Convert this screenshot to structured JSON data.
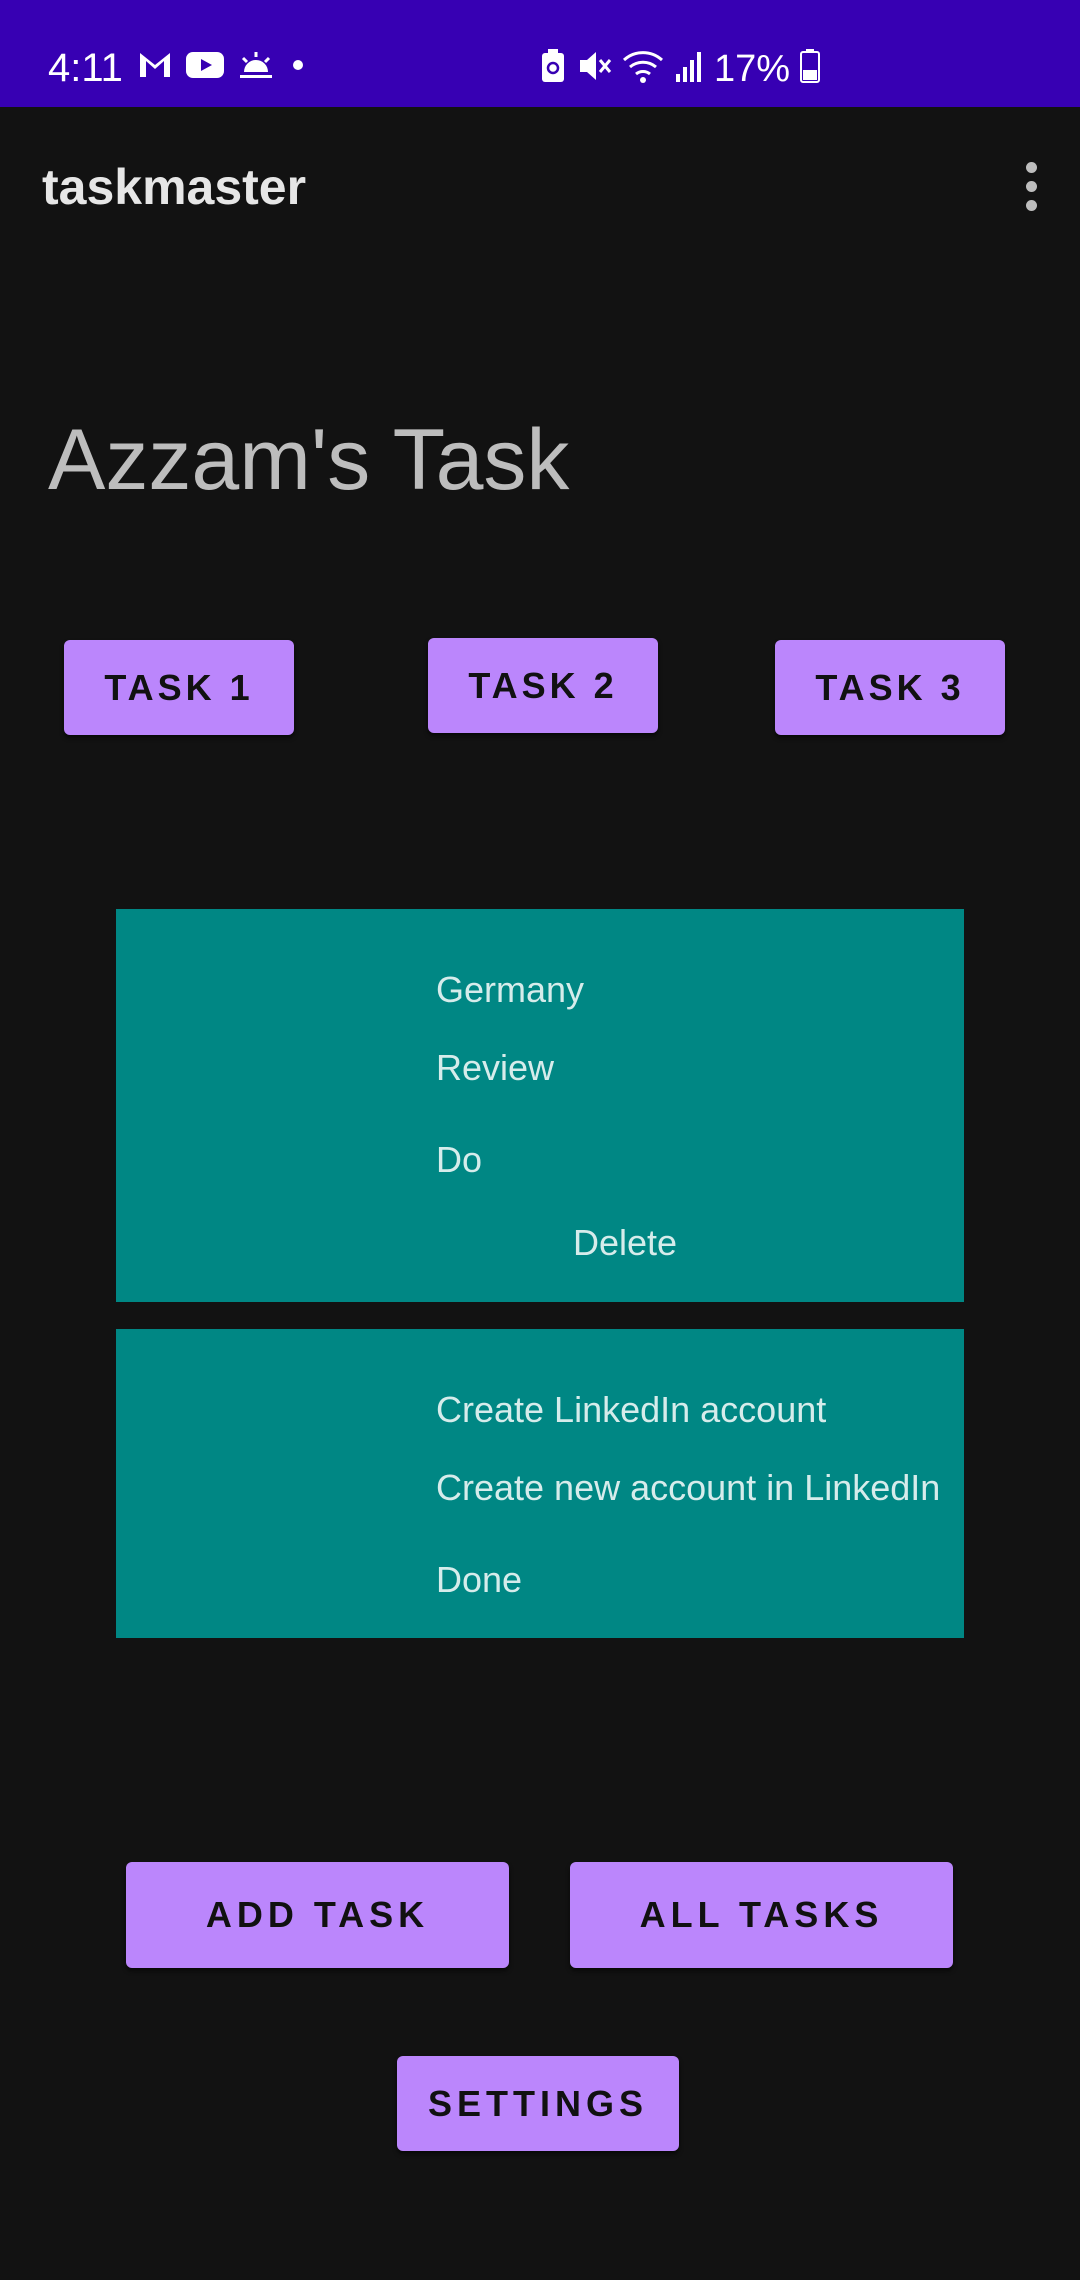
{
  "status_bar": {
    "time": "4:11",
    "battery": "17%",
    "left_icons": [
      "gmail-icon",
      "youtube-icon",
      "weather-icon",
      "dot-icon"
    ],
    "right_icons": [
      "battery-saver-icon",
      "mute-icon",
      "wifi-icon",
      "signal-icon",
      "battery-icon"
    ]
  },
  "app_bar": {
    "title": "taskmaster"
  },
  "heading": "Azzam's Task",
  "task_buttons": [
    "TASK 1",
    "TASK 2",
    "TASK 3"
  ],
  "tasks": [
    {
      "title": "Germany",
      "body": "Review",
      "state": "Do",
      "delete": "Delete"
    },
    {
      "title": "Create LinkedIn account",
      "body": "Create new account in LinkedIn",
      "state": "Done"
    }
  ],
  "actions": {
    "add_task": "ADD TASK",
    "all_tasks": "ALL TASKS",
    "settings": "SETTINGS"
  },
  "colors": {
    "status_bar": "#3700B3",
    "background": "#121212",
    "button": "#BB86FC",
    "card": "#008784"
  }
}
